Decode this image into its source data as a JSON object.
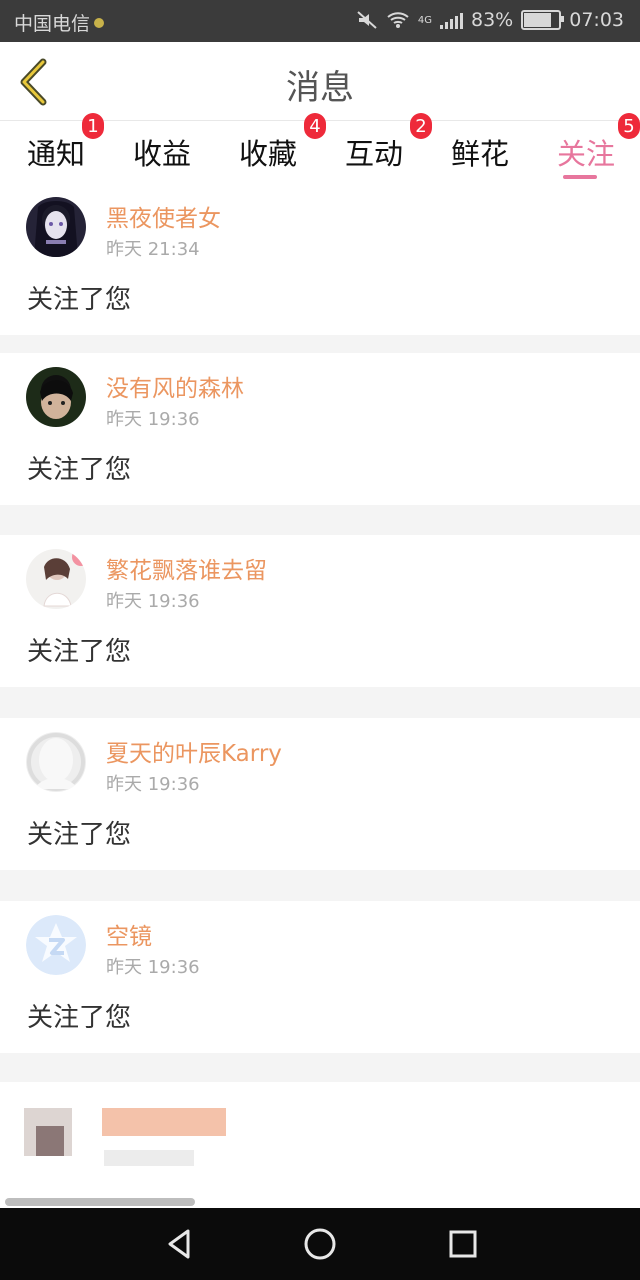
{
  "status_bar": {
    "carrier": "中国电信",
    "network": "4G",
    "battery": "83%",
    "battery_level": 0.83,
    "time": "07:03"
  },
  "header": {
    "back_icon": "chevron-left-icon",
    "title": "消息"
  },
  "tabs": [
    {
      "label": "通知",
      "badge": "1",
      "active": false
    },
    {
      "label": "收益",
      "badge": "",
      "active": false
    },
    {
      "label": "收藏",
      "badge": "4",
      "active": false
    },
    {
      "label": "互动",
      "badge": "2",
      "active": false
    },
    {
      "label": "鲜花",
      "badge": "",
      "active": false
    },
    {
      "label": "关注",
      "badge": "5",
      "active": true
    }
  ],
  "follow_items": [
    {
      "name": "黑夜使者女",
      "time": "昨天 21:34",
      "action": "关注了您",
      "avatar": "dark-anime-avatar"
    },
    {
      "name": "没有风的森林",
      "time": "昨天 19:36",
      "action": "关注了您",
      "avatar": "portrait-avatar"
    },
    {
      "name": "繁花飘落谁去留",
      "time": "昨天 19:36",
      "action": "关注了您",
      "avatar": "girl-avatar"
    },
    {
      "name": "夏天的叶辰Karry",
      "time": "昨天 19:36",
      "action": "关注了您",
      "avatar": "default-avatar"
    },
    {
      "name": "空镜",
      "time": "昨天 19:36",
      "action": "关注了您",
      "avatar": "qzone-avatar"
    }
  ],
  "colors": {
    "accent": "#e7769d",
    "name": "#eb9660",
    "badge": "#ee2a3a"
  },
  "android_nav": {
    "back_icon": "triangle-back-icon",
    "home_icon": "circle-home-icon",
    "recent_icon": "square-recent-icon"
  }
}
